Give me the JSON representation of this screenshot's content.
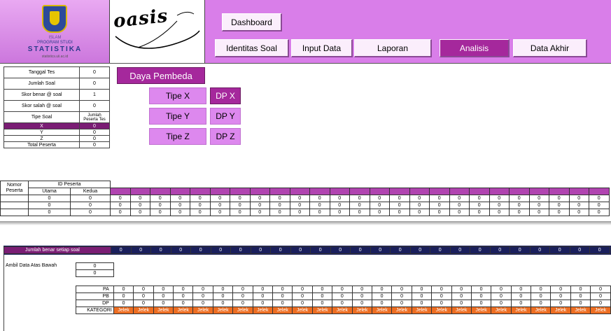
{
  "logo": {
    "small_text": "ISLAM",
    "prodi": "PROGRAM STUDI",
    "stat": "STATISTIKA",
    "url": "statistics.uii.ac.id"
  },
  "brand": {
    "name": "oasis"
  },
  "nav": {
    "dashboard": "Dashboard",
    "identitas": "Identitas Soal",
    "input": "Input Data",
    "laporan": "Laporan",
    "analisis": "Analisis",
    "data_akhir": "Data Akhir",
    "active": "analisis"
  },
  "params": {
    "tanggal_label": "Tanggal Tes",
    "tanggal_value": "0",
    "jumlah_soal_label": "Jumlah Soal",
    "jumlah_soal_value": "0",
    "skor_benar_label": "Skor benar @ soal",
    "skor_benar_value": "1",
    "skor_salah_label": "Skor salah @ soal",
    "skor_salah_value": "0",
    "tipe_soal_label": "Tipe Soal",
    "jumlah_peserta_label": "Jumlah Peserta Tes",
    "tipe_rows": [
      {
        "tipe": "X",
        "jumlah": "0",
        "selected": true
      },
      {
        "tipe": "Y",
        "jumlah": "0",
        "selected": false
      },
      {
        "tipe": "Z",
        "jumlah": "0",
        "selected": false
      }
    ],
    "total_label": "Total Peserta",
    "total_value": "0"
  },
  "analysis": {
    "daya_pembeda": "Daya Pembeda",
    "tipe_x": "Tipe X",
    "dp_x": "DP X",
    "tipe_y": "Tipe Y",
    "dp_y": "DP Y",
    "tipe_z": "Tipe Z",
    "dp_z": "DP Z"
  },
  "peserta_table": {
    "nomor_label": "Nomor Peserta",
    "id_label": "ID Peserta",
    "utama_label": "Utama",
    "kedua_label": "Kedua",
    "rows": [
      {
        "utama": "0",
        "kedua": "0"
      },
      {
        "utama": "0",
        "kedua": "0"
      },
      {
        "utama": "0",
        "kedua": "0"
      }
    ],
    "cell_value": "0",
    "num_columns": 25
  },
  "jumlah_benar": {
    "label": "Jumlah benar setiap soal",
    "cell_value": "0"
  },
  "ambil": {
    "label": "Ambil Data Atas Bawah",
    "values": [
      "0",
      "0"
    ]
  },
  "stats_table": {
    "rows": [
      {
        "label": "PA",
        "value": "0"
      },
      {
        "label": "PB",
        "value": "0"
      },
      {
        "label": "DP",
        "value": "0"
      },
      {
        "label": "KATEGORI",
        "value": "Jelek"
      }
    ]
  },
  "colors": {
    "accent_purple": "#a5289c",
    "nav_bg": "#d97ee9",
    "navy": "#1a1f5c",
    "kategori_orange": "#ee6e22"
  }
}
